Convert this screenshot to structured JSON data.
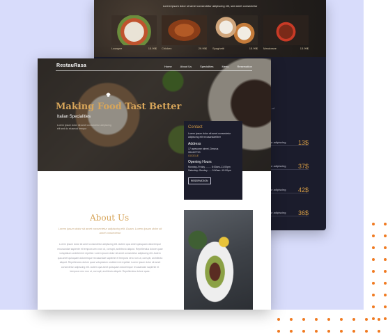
{
  "back_page": {
    "top_text": "Lorem ipsum dolor sit amet consectetur adipiscing elit, sed amet consectetur",
    "food_cards": [
      {
        "name": "Lasagne",
        "price": "15.99$"
      },
      {
        "name": "Chicken",
        "price": "29.99$"
      },
      {
        "name": "Spaghetti",
        "price": "15.99$"
      },
      {
        "name": "Meatcrane",
        "price": "13.99$"
      }
    ],
    "side_text": "...d",
    "menu_rows": [
      {
        "desc": "ur adipiscing",
        "price": "13$"
      },
      {
        "desc": "ur adipiscing",
        "price": "37$"
      },
      {
        "desc": "ur adipiscing",
        "price": "42$"
      },
      {
        "desc": "ur adipiscing",
        "price": "36$"
      }
    ]
  },
  "front_page": {
    "logo": "RestauRasa",
    "nav": [
      "Home",
      "About Us",
      "Specialties",
      "Menu",
      "Reservation"
    ],
    "hero_title": "Making Food Tast Better",
    "hero_subtitle": "Italian Specialities",
    "hero_desc": "Lorem ipsum dolor sit amet consectetur adipiscing elit sed do eiusmod tempor",
    "contact": {
      "title": "Contact",
      "intro": "Lorem ipsum dolor sit amet consectetur adipiscing elit recusandaeliber",
      "address_label": "Address",
      "address": "17 awesome street, Denzus",
      "phone": "084457700",
      "link": "GOOGLE",
      "hours_label": "Opening Hours",
      "hours_weekday": "Monday–Friday ........ 8:00am–11:00pm",
      "hours_weekend": "Saturday–Sunday ..... 9:00am–10:00pm",
      "button": "RESERVATION"
    },
    "about_title": "About Us",
    "about_intro": "Lorem ipsum dolor sit amet consectetur adipiscing elit. Duam. Lorem ipsum dolor sit amet consectetur",
    "about_body": "Lorem ipsum dolor sit amet consectetur adipiscing elit. Autem qua amet quisquam doloremque recusandae sapiente et tempora vero non ut, corrupti, architecto aliquid. Repellendus dolore quae voluptatum undeterrent repellat. Lorem ipsum dolor sit amet consectetur adipiscing elit. Autem qua amet quisquam doloremque recusandae sapiente et tempora vero non ut, corrupti, architecto aliquid. Repellendus dolore quae voluptatum undeterrent repellat. Lorem ipsum dolor sit amet consectetur adipiscing elit. Autem qua amet quisquam doloremque recusandae sapiente et tempora vero non ut, corrupti, architecto aliquid. Repellendus dolore quae."
  },
  "colors": {
    "accent_gold": "#d7a55a",
    "dot_orange": "#f07a21",
    "backdrop": "#d8dcfb",
    "dark_card": "#1c1d2c"
  }
}
